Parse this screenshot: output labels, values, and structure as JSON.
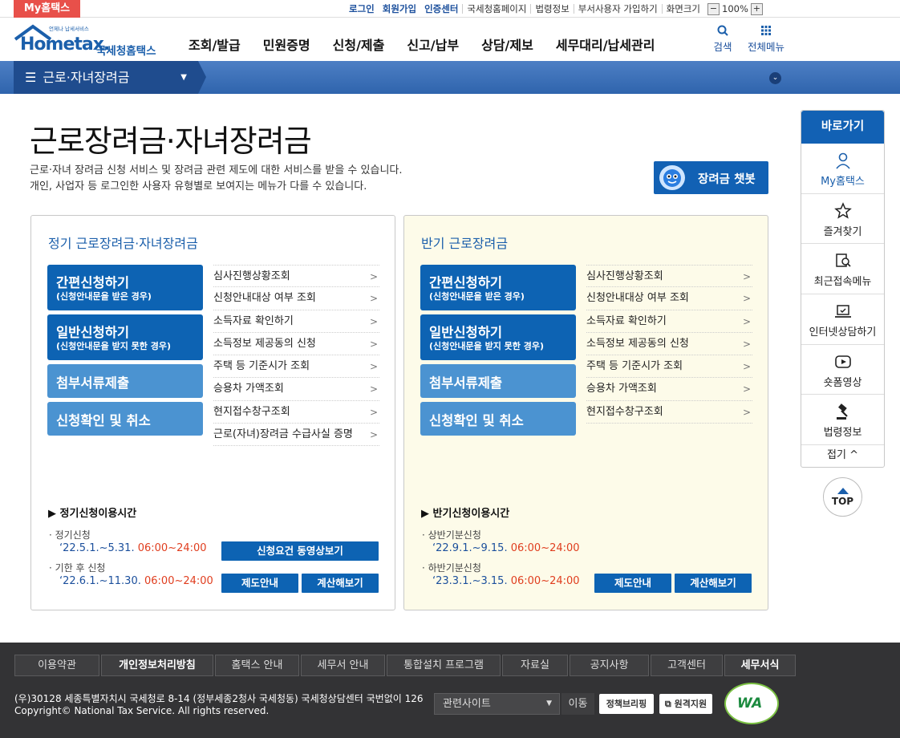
{
  "topbar": {
    "my_tab": "My홈택스",
    "links": [
      "로그인",
      "회원가입",
      "인증센터",
      "국세청홈페이지",
      "법령정보",
      "부서사용자 가입하기"
    ],
    "zoom_label": "화면크기",
    "zoom_value": "100%",
    "zoom_minus": "−",
    "zoom_plus": "+"
  },
  "header": {
    "logo_small": "언제나 납세서비스",
    "logo_main": "Hometax.",
    "logo_kor": "국세청홈택스",
    "nav": [
      "조회/발급",
      "민원증명",
      "신청/제출",
      "신고/납부",
      "상담/제보",
      "세무대리/납세관리"
    ],
    "search_label": "검색",
    "allmenu_label": "전체메뉴"
  },
  "subbar": {
    "selected": "근로·자녀장려금"
  },
  "page": {
    "title": "근로장려금·자녀장려금",
    "desc1": "근로·자녀 장려금 신청 서비스 및 장려금 관련 제도에 대한 서비스를 받을 수 있습니다.",
    "desc2": "개인, 사업자 등 로그인한 사용자 유형별로 보여지는 메뉴가 다를 수 있습니다.",
    "chatbot": "장려금 챗봇"
  },
  "left_panel": {
    "title": "정기 근로장려금·자녀장려금",
    "buttons": [
      {
        "main": "간편신청하기",
        "sub": "(신청안내문을 받은 경우)"
      },
      {
        "main": "일반신청하기",
        "sub": "(신청안내문을 받지 못한 경우)"
      },
      {
        "main": "첨부서류제출",
        "sub": ""
      },
      {
        "main": "신청확인 및 취소",
        "sub": ""
      }
    ],
    "links": [
      "심사진행상황조회",
      "신청안내대상 여부 조회",
      "소득자료 확인하기",
      "소득정보 제공동의 신청",
      "주택 등 기준시가 조회",
      "승용차 가액조회",
      "현지접수창구조회",
      "근로(자녀)장려금 수급사실 증명"
    ],
    "usage_title": "▶ 정기신청이용시간",
    "usage": [
      {
        "label": "· 정기신청",
        "date": "‘22.5.1.~5.31.",
        "time": "06:00~24:00"
      },
      {
        "label": "· 기한 후 신청",
        "date": "‘22.6.1.~11.30.",
        "time": "06:00~24:00"
      }
    ],
    "btn_video": "신청요건 동영상보기",
    "btn_guide": "제도안내",
    "btn_calc": "계산해보기"
  },
  "right_panel": {
    "title": "반기 근로장려금",
    "buttons": [
      {
        "main": "간편신청하기",
        "sub": "(신청안내문을 받은 경우)"
      },
      {
        "main": "일반신청하기",
        "sub": "(신청안내문을 받지 못한 경우)"
      },
      {
        "main": "첨부서류제출",
        "sub": ""
      },
      {
        "main": "신청확인 및 취소",
        "sub": ""
      }
    ],
    "links": [
      "심사진행상황조회",
      "신청안내대상 여부 조회",
      "소득자료 확인하기",
      "소득정보 제공동의 신청",
      "주택 등 기준시가 조회",
      "승용차 가액조회",
      "현지접수창구조회"
    ],
    "usage_title": "▶ 반기신청이용시간",
    "usage": [
      {
        "label": "· 상반기분신청",
        "date": "‘22.9.1.~9.15.",
        "time": "06:00~24:00"
      },
      {
        "label": "· 하반기분신청",
        "date": "‘23.3.1.~3.15.",
        "time": "06:00~24:00"
      }
    ],
    "btn_guide": "제도안내",
    "btn_calc": "계산해보기"
  },
  "quick": {
    "title": "바로가기",
    "items": [
      {
        "label": "My홈택스",
        "icon": "person-icon"
      },
      {
        "label": "즐겨찾기",
        "icon": "star-icon"
      },
      {
        "label": "최근접속메뉴",
        "icon": "recent-search-icon"
      },
      {
        "label": "인터넷상담하기",
        "icon": "laptop-check-icon"
      },
      {
        "label": "숏폼영상",
        "icon": "play-icon"
      },
      {
        "label": "법령정보",
        "icon": "gavel-icon"
      }
    ],
    "fold": "접기 ^",
    "top": "TOP"
  },
  "footer": {
    "menu": [
      "이용약관",
      "개인정보처리방침",
      "홈택스 안내",
      "세무서 안내",
      "통합설치 프로그램",
      "자료실",
      "공지사항",
      "고객센터",
      "세무서식"
    ],
    "addr1": "(우)30128 세종특별자치시 국세청로 8-14 (정부세종2청사 국세청동) 국세청상담센터 국번없이 126",
    "addr2": "Copyright© National Tax Service. All rights reserved.",
    "related": "관련사이트",
    "go": "이동",
    "briefing": "정책브리핑",
    "remote": "원격지원",
    "wa": "WA"
  },
  "colors": {
    "primary": "#0d63b3",
    "light_button": "#4b93d1",
    "accent_red": "#e03d1e",
    "footer": "#333335"
  }
}
